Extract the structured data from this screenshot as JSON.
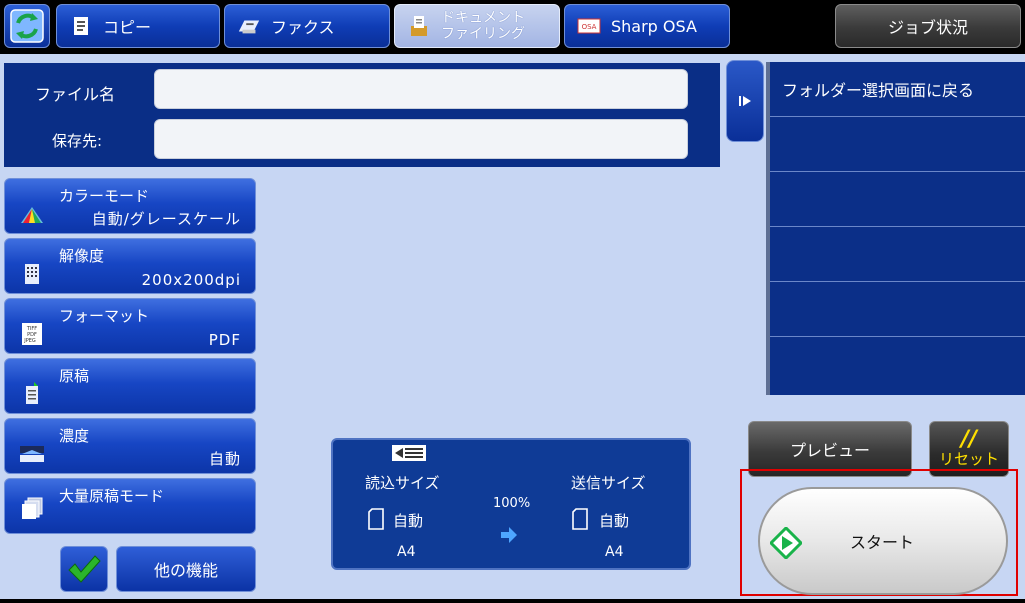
{
  "topbar": {
    "tabs": [
      {
        "label": "コピー",
        "icon": "copy-icon"
      },
      {
        "label": "ファクス",
        "icon": "fax-icon"
      },
      {
        "label": "ドキュメント ファイリング",
        "label_line1": "ドキュメント",
        "label_line2": "ファイリング",
        "icon": "document-filing-icon",
        "active": true
      },
      {
        "label": "Sharp OSA",
        "icon": "osa-icon"
      }
    ],
    "job_status": "ジョブ状況"
  },
  "file_panel": {
    "filename_label": "ファイル名",
    "filename_value": "",
    "dest_label": "保存先:",
    "dest_value": ""
  },
  "folder_panel": {
    "back_label": "フォルダー選択画面に戻る"
  },
  "settings": [
    {
      "title": "カラーモード",
      "value": "自動/グレースケール",
      "icon": "color-mode-icon"
    },
    {
      "title": "解像度",
      "value": "200x200dpi",
      "icon": "resolution-icon"
    },
    {
      "title": "フォーマット",
      "value": "PDF",
      "icon": "format-icon",
      "icon_text": [
        "TIFF",
        "PDF",
        "JPEG"
      ]
    },
    {
      "title": "原稿",
      "value": "",
      "icon": "original-icon"
    },
    {
      "title": "濃度",
      "value": "自動",
      "icon": "exposure-icon"
    },
    {
      "title": "大量原稿モード",
      "value": "",
      "icon": "job-build-icon"
    }
  ],
  "bottom_left": {
    "other_functions": "他の機能"
  },
  "size_panel": {
    "scan_size_label": "読込サイズ",
    "scan_mode": "自動",
    "scan_paper": "A4",
    "ratio": "100%",
    "send_size_label": "送信サイズ",
    "send_mode": "自動",
    "send_paper": "A4"
  },
  "actions": {
    "preview": "プレビュー",
    "reset": "リセット",
    "reset_symbol": "//",
    "start": "スタート"
  },
  "colors": {
    "background": "#c7d6f3",
    "panel_dark_blue": "#0a2e86",
    "button_blue": "#1746c4",
    "reset_yellow": "#ffe000",
    "start_green": "#19b34a",
    "highlight_red": "#e00000"
  }
}
